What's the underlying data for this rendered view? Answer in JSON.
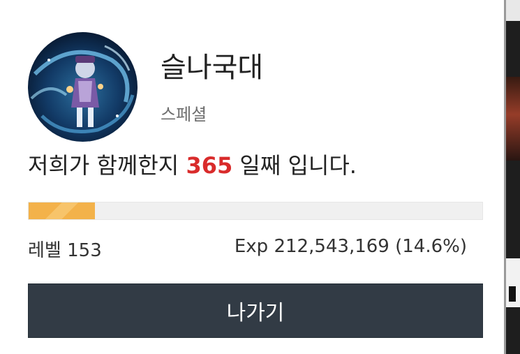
{
  "profile": {
    "name": "슬나국대",
    "grade": "스페셜",
    "avatar_icon": "anime-character-avatar"
  },
  "membership": {
    "prefix": "저희가 함께한지 ",
    "days": "365",
    "suffix": " 일째 입니다."
  },
  "level": {
    "label": "레벨 153",
    "exp_text": "Exp 212,543,169 (14.6%)",
    "progress_fraction": 0.146
  },
  "actions": {
    "exit_label": "나가기"
  },
  "colors": {
    "days_highlight": "#d92b2b",
    "progress_fill": "#f3b24a",
    "button_bg": "#323b45"
  }
}
